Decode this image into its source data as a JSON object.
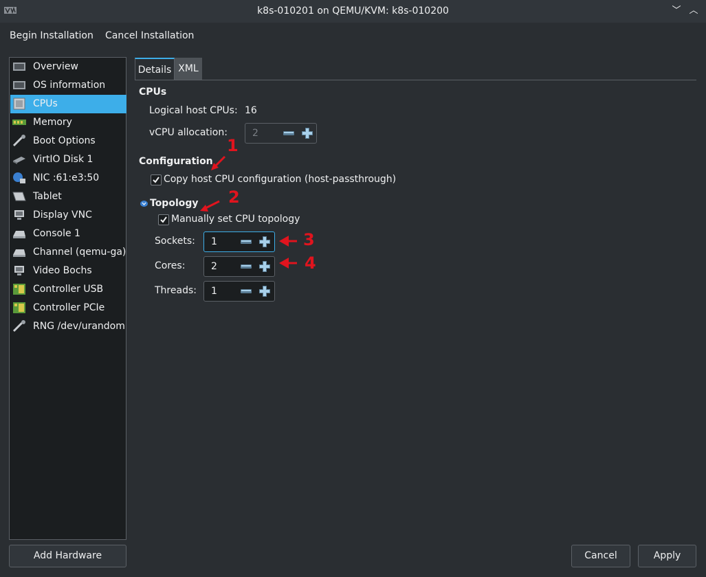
{
  "window": {
    "title": "k8s-010201 on QEMU/KVM: k8s-010200",
    "app_icon": "vmm-icon",
    "minimize_glyph": "﹀",
    "maximize_glyph": "︿",
    "close_glyph": "✕"
  },
  "menu": {
    "begin": "Begin Installation",
    "cancel": "Cancel Installation"
  },
  "sidebar": {
    "items": [
      {
        "label": "Overview",
        "icon": "overview-icon"
      },
      {
        "label": "OS information",
        "icon": "os-info-icon"
      },
      {
        "label": "CPUs",
        "icon": "cpu-icon"
      },
      {
        "label": "Memory",
        "icon": "memory-icon"
      },
      {
        "label": "Boot Options",
        "icon": "boot-options-icon"
      },
      {
        "label": "VirtIO Disk 1",
        "icon": "disk-icon"
      },
      {
        "label": "NIC :61:e3:50",
        "icon": "nic-icon"
      },
      {
        "label": "Tablet",
        "icon": "tablet-icon"
      },
      {
        "label": "Display VNC",
        "icon": "display-icon"
      },
      {
        "label": "Console 1",
        "icon": "console-icon"
      },
      {
        "label": "Channel (qemu-ga)",
        "icon": "channel-icon"
      },
      {
        "label": "Video Bochs",
        "icon": "video-icon"
      },
      {
        "label": "Controller USB",
        "icon": "controller-icon"
      },
      {
        "label": "Controller PCIe",
        "icon": "controller-icon"
      },
      {
        "label": "RNG /dev/urandom",
        "icon": "rng-icon"
      }
    ],
    "selected": "CPUs",
    "add_hardware": "Add Hardware"
  },
  "tabs": [
    {
      "label": "Details"
    },
    {
      "label": "XML"
    }
  ],
  "cpus": {
    "heading": "CPUs",
    "logical_label": "Logical host CPUs:",
    "logical_value": "16",
    "vcpu_label": "vCPU allocation:",
    "vcpu_value": "2"
  },
  "configuration": {
    "heading": "Configuration",
    "copy_host_label": "Copy host CPU configuration (host-passthrough)",
    "copy_host_checked": true
  },
  "topology": {
    "heading": "Topology",
    "manual_label": "Manually set CPU topology",
    "manual_checked": true,
    "sockets_label": "Sockets:",
    "sockets_value": "1",
    "cores_label": "Cores:",
    "cores_value": "2",
    "threads_label": "Threads:",
    "threads_value": "1"
  },
  "annotations": [
    "1",
    "2",
    "3",
    "4"
  ],
  "buttons": {
    "cancel": "Cancel",
    "apply": "Apply"
  },
  "colors": {
    "accent": "#3daee9",
    "background": "#2a2e32",
    "annotation": "#e0141e"
  }
}
